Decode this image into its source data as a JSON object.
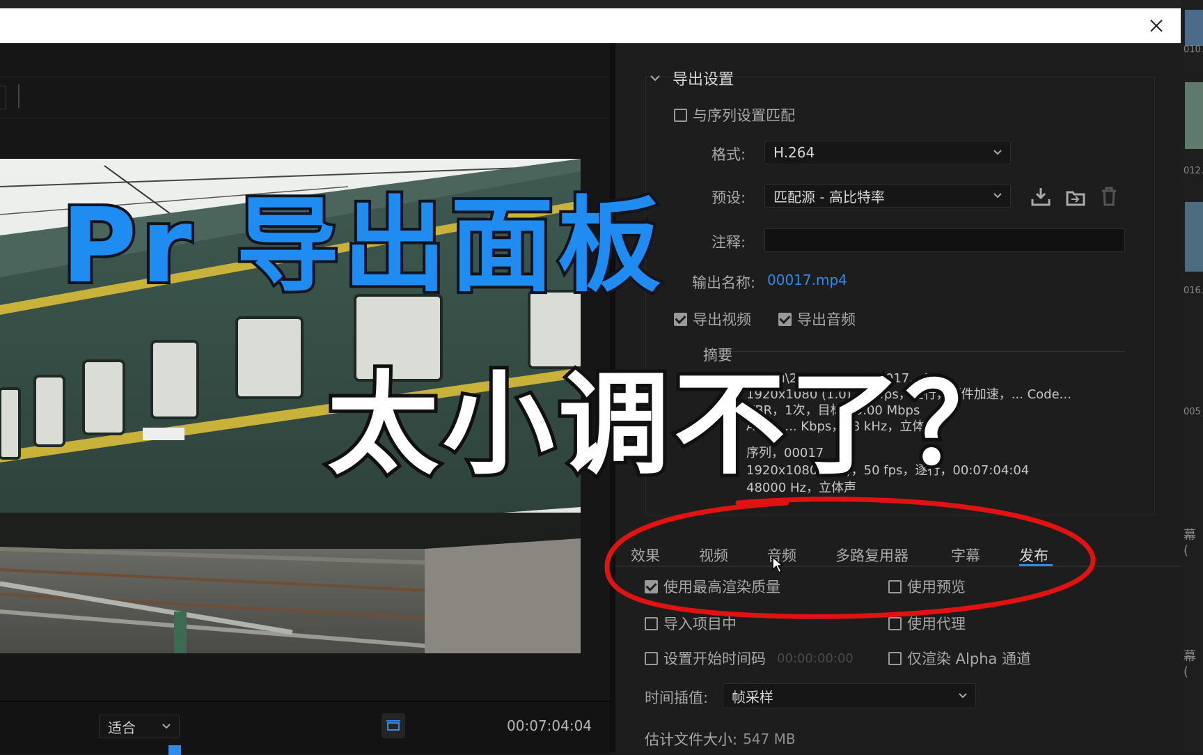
{
  "export_settings": {
    "section_title": "导出设置",
    "match_sequence_label": "与序列设置匹配",
    "match_sequence_checked": false,
    "format_label": "格式:",
    "format_value": "H.264",
    "preset_label": "预设:",
    "preset_value": "匹配源 - 高比特率",
    "comment_label": "注释:",
    "comment_value": "",
    "output_name_label": "输出名称:",
    "output_name_value": "00017.mp4",
    "export_video_label": "导出视频",
    "export_video_checked": true,
    "export_audio_label": "导出音频",
    "export_audio_checked": true,
    "summary_label": "摘要",
    "output_label": "输出:",
    "output_lines": [
      "F:\\...\\u\\20210505\\d\\00017...4",
      "1920x1080 (1.0)，50fps，逐行，硬件加速，... Code...",
      "VBR，1次，目标 10.00 Mbps",
      "AAC，... Kbps，48 kHz，立体声"
    ],
    "source_label": "源:",
    "source_lines": [
      "序列，00017",
      "1920x1080 (1.0)，50 fps，逐行，00:07:04:04",
      "48000 Hz，立体声"
    ]
  },
  "tabs": [
    {
      "label": "效果",
      "active": false
    },
    {
      "label": "视频",
      "active": false
    },
    {
      "label": "音频",
      "active": false
    },
    {
      "label": "多路复用器",
      "active": false
    },
    {
      "label": "字幕",
      "active": false
    },
    {
      "label": "发布",
      "active": true
    }
  ],
  "options": {
    "max_render_quality": {
      "label": "使用最高渲染质量",
      "checked": true
    },
    "use_previews": {
      "label": "使用预览",
      "checked": false
    },
    "import_into_project": {
      "label": "导入项目中",
      "checked": false
    },
    "use_proxies": {
      "label": "使用代理",
      "checked": false
    },
    "set_start_timecode": {
      "label": "设置开始时间码",
      "checked": false,
      "timecode": "00:00:00:00"
    },
    "render_alpha_only": {
      "label": "仅渲染 Alpha 通道",
      "checked": false
    }
  },
  "time_interpolation": {
    "label": "时间插值:",
    "value": "帧采样"
  },
  "file_size": {
    "label": "估计文件大小:",
    "value": "547 MB"
  },
  "preview": {
    "fit_label": "适合",
    "timecode": "00:07:04:04"
  },
  "overlay": {
    "line1": "Pr 导出面板",
    "line2": "太小调不了？"
  },
  "edge_labels": [
    "010.",
    "012.",
    "016.",
    "005",
    "幕 (",
    "幕 ("
  ],
  "colors": {
    "accent_blue": "#2d8ceb",
    "annotation_red": "#e01212",
    "overlay_blue": "#1f8cf2"
  },
  "icons": {
    "close": "close-icon",
    "save_preset": "download-icon",
    "import_preset": "folder-import-icon",
    "delete_preset": "trash-icon",
    "fit_toggle": "fit-frame-icon"
  }
}
